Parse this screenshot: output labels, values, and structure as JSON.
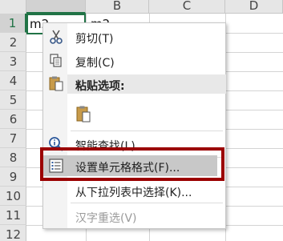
{
  "columns": [
    "B",
    "C",
    "D"
  ],
  "rows": [
    "1",
    "2",
    "3",
    "4",
    "5",
    "6",
    "7",
    "8",
    "9",
    "10",
    "11",
    "12"
  ],
  "cells": {
    "a1": "m2",
    "b1": "m2"
  },
  "menu": {
    "items": [
      {
        "label": "剪切(T)",
        "icon": "scissors-icon",
        "disabled": false
      },
      {
        "label": "复制(C)",
        "icon": "copy-icon",
        "disabled": false
      },
      {
        "label": "粘贴选项:",
        "icon": "paste-icon",
        "disabled": false
      },
      {
        "label": "",
        "icon": "paste-option-icon",
        "disabled": false
      },
      {
        "label": "智能查找(L)",
        "icon": "smart-lookup-icon",
        "disabled": false
      },
      {
        "label": "设置单元格格式(F)...",
        "icon": "format-cells-icon",
        "disabled": false
      },
      {
        "label": "从下拉列表中选择(K)...",
        "icon": "",
        "disabled": false
      },
      {
        "label": "汉字重选(V)",
        "icon": "",
        "disabled": true
      }
    ]
  },
  "colors": {
    "accent": "#217346",
    "highlight_border": "#9b0000"
  }
}
